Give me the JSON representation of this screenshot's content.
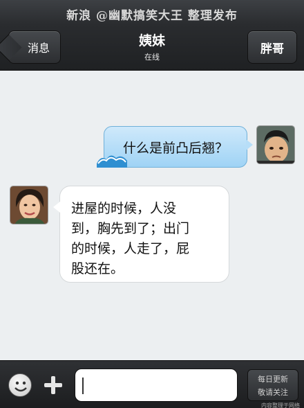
{
  "watermark": "新浪 @幽默搞笑大王 整理发布",
  "header": {
    "back_label": "消息",
    "title": "姨妹",
    "status": "在线",
    "right_label": "胖哥"
  },
  "messages": [
    {
      "side": "out",
      "text": "什么是前凸后翘？"
    },
    {
      "side": "in",
      "lines": [
        "进屋的时候，人没",
        "到，胸先到了；出门",
        "的时候，人走了，屁",
        "股还在。"
      ]
    }
  ],
  "footer": {
    "input_value": "",
    "follow_line1": "每日更新",
    "follow_line2": "敬请关注",
    "small_note": "内容整理于网络"
  },
  "colors": {
    "bar": "#2a2c2f",
    "out_bubble": "#b7def8",
    "in_bubble": "#ffffff",
    "background": "#eceff1"
  }
}
